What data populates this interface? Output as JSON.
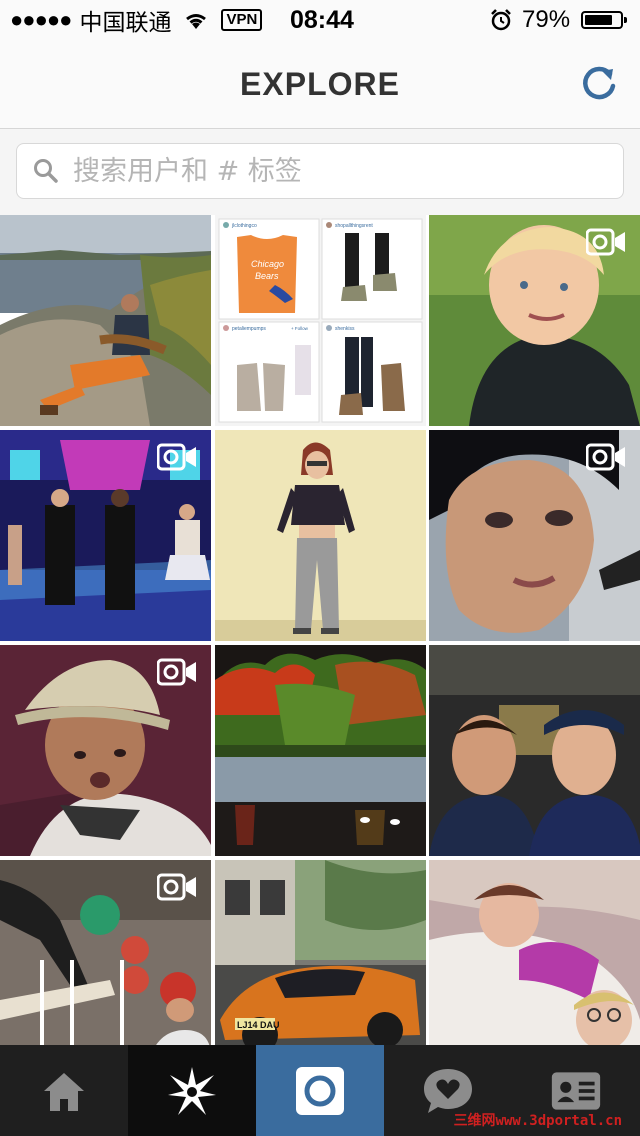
{
  "status_bar": {
    "signal": "●●●●●",
    "carrier": "中国联通",
    "vpn": "VPN",
    "time": "08:44",
    "battery_percent": "79%",
    "battery_level": 0.79
  },
  "header": {
    "title": "EXPLORE",
    "refresh_icon": "refresh-icon"
  },
  "search": {
    "placeholder": "搜索用户和 # 标签",
    "value": ""
  },
  "grid": {
    "tiles": [
      {
        "subject": "man with guitar on rocky shore",
        "video": false
      },
      {
        "subject": "product collage",
        "video": false
      },
      {
        "subject": "blond boy selfie",
        "video": true
      },
      {
        "subject": "dance show on stage",
        "video": true
      },
      {
        "subject": "woman in crop top",
        "video": false
      },
      {
        "subject": "woman makeup close-up",
        "video": true
      },
      {
        "subject": "boy in bucket hat",
        "video": true
      },
      {
        "subject": "autumn trees by lake",
        "video": false
      },
      {
        "subject": "two men selfie",
        "video": false
      },
      {
        "subject": "skateboarding indoors",
        "video": true
      },
      {
        "subject": "orange sports car",
        "video": false
      },
      {
        "subject": "children lying in bed",
        "video": false
      }
    ],
    "collage": {
      "top_left_user": "jlclothingco",
      "top_right_user": "shopallthingsrent",
      "bottom_left_user": "petaliempumps",
      "bottom_right_user": "shenkiss",
      "follow_label": "+ Follow"
    },
    "plate_text": "LJ14 DAU"
  },
  "tabbar": {
    "items": [
      {
        "name": "home",
        "icon": "home-icon"
      },
      {
        "name": "explore",
        "icon": "explore-star-icon"
      },
      {
        "name": "camera",
        "icon": "camera-icon"
      },
      {
        "name": "activity",
        "icon": "heart-bubble-icon"
      },
      {
        "name": "profile",
        "icon": "profile-card-icon"
      }
    ]
  },
  "watermark": "三维网www.3dportal.cn",
  "colors": {
    "accent_blue": "#3a6c9e",
    "tabbar_bg": "#1f1f1f",
    "header_bg": "#fafafa"
  }
}
